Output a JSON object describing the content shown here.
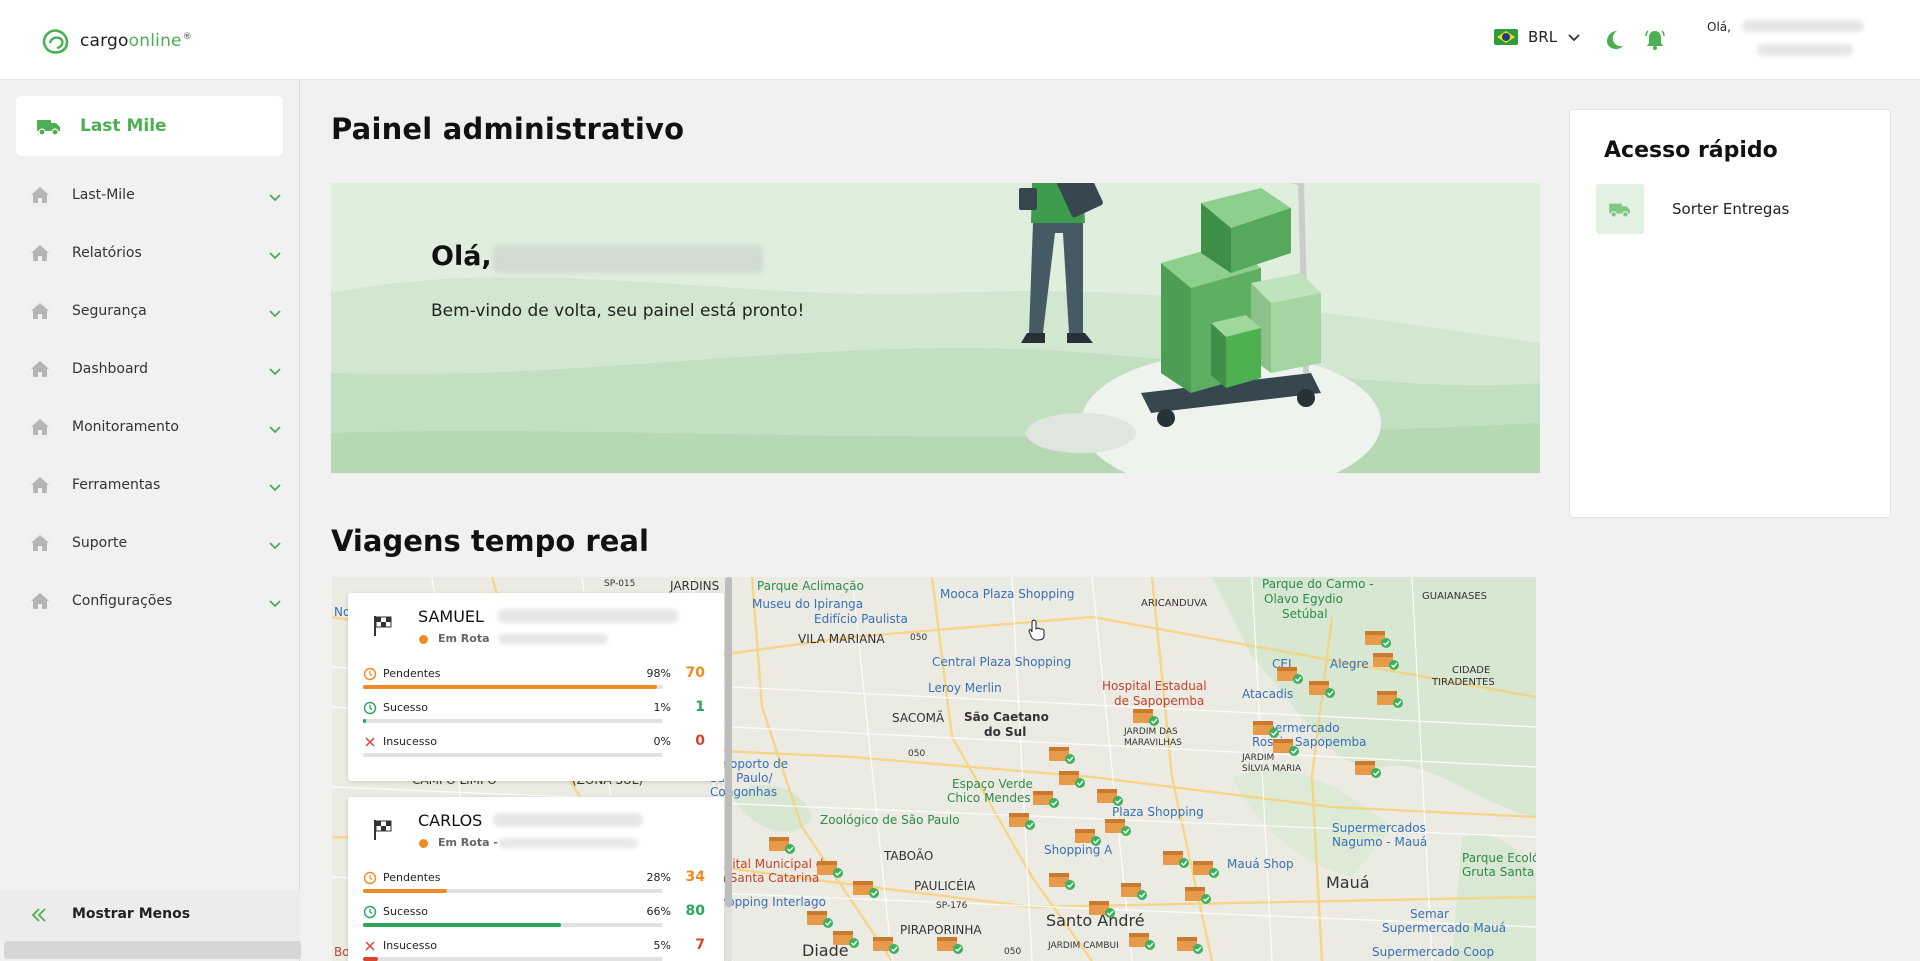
{
  "header": {
    "brand": {
      "prefix": "cargo",
      "suffix": "online",
      "mark": "®"
    },
    "currency": "BRL",
    "greeting": "Olá,"
  },
  "sidebar": {
    "module": "Last Mile",
    "items": [
      {
        "label": "Last-Mile"
      },
      {
        "label": "Relatórios"
      },
      {
        "label": "Segurança"
      },
      {
        "label": "Dashboard"
      },
      {
        "label": "Monitoramento"
      },
      {
        "label": "Ferramentas"
      },
      {
        "label": "Suporte"
      },
      {
        "label": "Configurações"
      }
    ],
    "collapse_label": "Mostrar Menos"
  },
  "main": {
    "title": "Painel administrativo",
    "welcome": {
      "hello": "Olá,",
      "subtitle": "Bem-vindo de volta, seu painel está pronto!"
    },
    "quick_access": {
      "title": "Acesso rápido",
      "items": [
        {
          "label": "Sorter Entregas"
        }
      ]
    },
    "trips_title": "Viagens tempo real",
    "trips": [
      {
        "name": "SAMUEL",
        "status": "Em Rota",
        "metrics": [
          {
            "label": "Pendentes",
            "pct": "98%",
            "value": "70",
            "fill": 0.98
          },
          {
            "label": "Sucesso",
            "pct": "1%",
            "value": "1",
            "fill": 0.01
          },
          {
            "label": "Insucesso",
            "pct": "0%",
            "value": "0",
            "fill": 0.0
          }
        ]
      },
      {
        "name": "CARLOS",
        "status": "Em Rota -",
        "metrics": [
          {
            "label": "Pendentes",
            "pct": "28%",
            "value": "34",
            "fill": 0.28
          },
          {
            "label": "Sucesso",
            "pct": "66%",
            "value": "80",
            "fill": 0.66
          },
          {
            "label": "Insucesso",
            "pct": "5%",
            "value": "7",
            "fill": 0.05
          }
        ]
      }
    ],
    "map_labels": {
      "novo_osasco": "Novo Osasco",
      "jardins": "JARDINS",
      "sp015": "SP-015",
      "parque_aclimacao": "Parque Aclimação",
      "museu": "Museu do Ipiranga",
      "edificio": "Edifício Paulista",
      "mooca": "Mooca Plaza Shopping",
      "aricanduva": "ARICANDUVA",
      "parque_carmo": "Parque do Carmo -",
      "olavo": "Olavo Egydio",
      "setubal": "Setúbal",
      "guaianases": "GUAIANASES",
      "vila_mariana": "VILA MARIANA",
      "r050a": "050",
      "central_plaza": "Central Plaza Shopping",
      "hospital_sapopemba": "Hospital Estadual",
      "hospital_sapopemba2": "de Sapopemba",
      "leroy": "Leroy Merlin",
      "sacoma": "SACOMÃ",
      "sao_caetano": "São Caetano",
      "do_sul": "do Sul",
      "jardim_maravilhas": "JARDIM DAS",
      "maravilhas": "MARAVILHAS",
      "cel": "CEL",
      "alegre": "Alegre",
      "atacadis": "Atacadis",
      "cidade": "CIDADE",
      "tiradentes": "TIRADENTES",
      "supermercado_rossi": "Supermercado",
      "rossi": "Rossi - Sapopemba",
      "jardim_silvia": "JARDIM",
      "silvia_maria": "SÍLVIA MARIA",
      "campo_limpo": "CAMPO LIMPO",
      "zona_sul": "(ZONA SUL)",
      "aeroporto": "Aeroporto de",
      "sao_paulo": "São Paulo/",
      "congonhas": "Congonhas",
      "r050b": "050",
      "espaco_verde": "Espaço Verde",
      "chico": "Chico Mendes",
      "plaza_shopping": "Plaza Shopping",
      "zoologico": "Zoológico de São Paulo",
      "super_nagumo": "Supermercados",
      "nagumo": "Nagumo - Mauá",
      "parque_eco": "Parque Ecológ",
      "gruta": "Gruta Santa Lu",
      "taboao": "TABOÃO",
      "hospital_vila": "Hospital Municipal da",
      "vila_catarina": "Vila Santa Catarina",
      "shopping_interlagos": "Shopping Interlago",
      "pauliceia": "PAULICÉIA",
      "sp176": "SP-176",
      "shopping_abc": "Shopping A",
      "maua": "Mauá",
      "semar": "Semar",
      "super_maua": "Supermercado Mauá",
      "santo_andre": "Santo André",
      "piraporinha": "PIRAPORINHA",
      "jardim_cambui": "JARDIM CAMBUI",
      "r050c": "050",
      "diadema": "Diade",
      "boi": "Boi",
      "super_coop": "Supermercado Coop",
      "mauá_shop": "Mauá Shop"
    }
  }
}
